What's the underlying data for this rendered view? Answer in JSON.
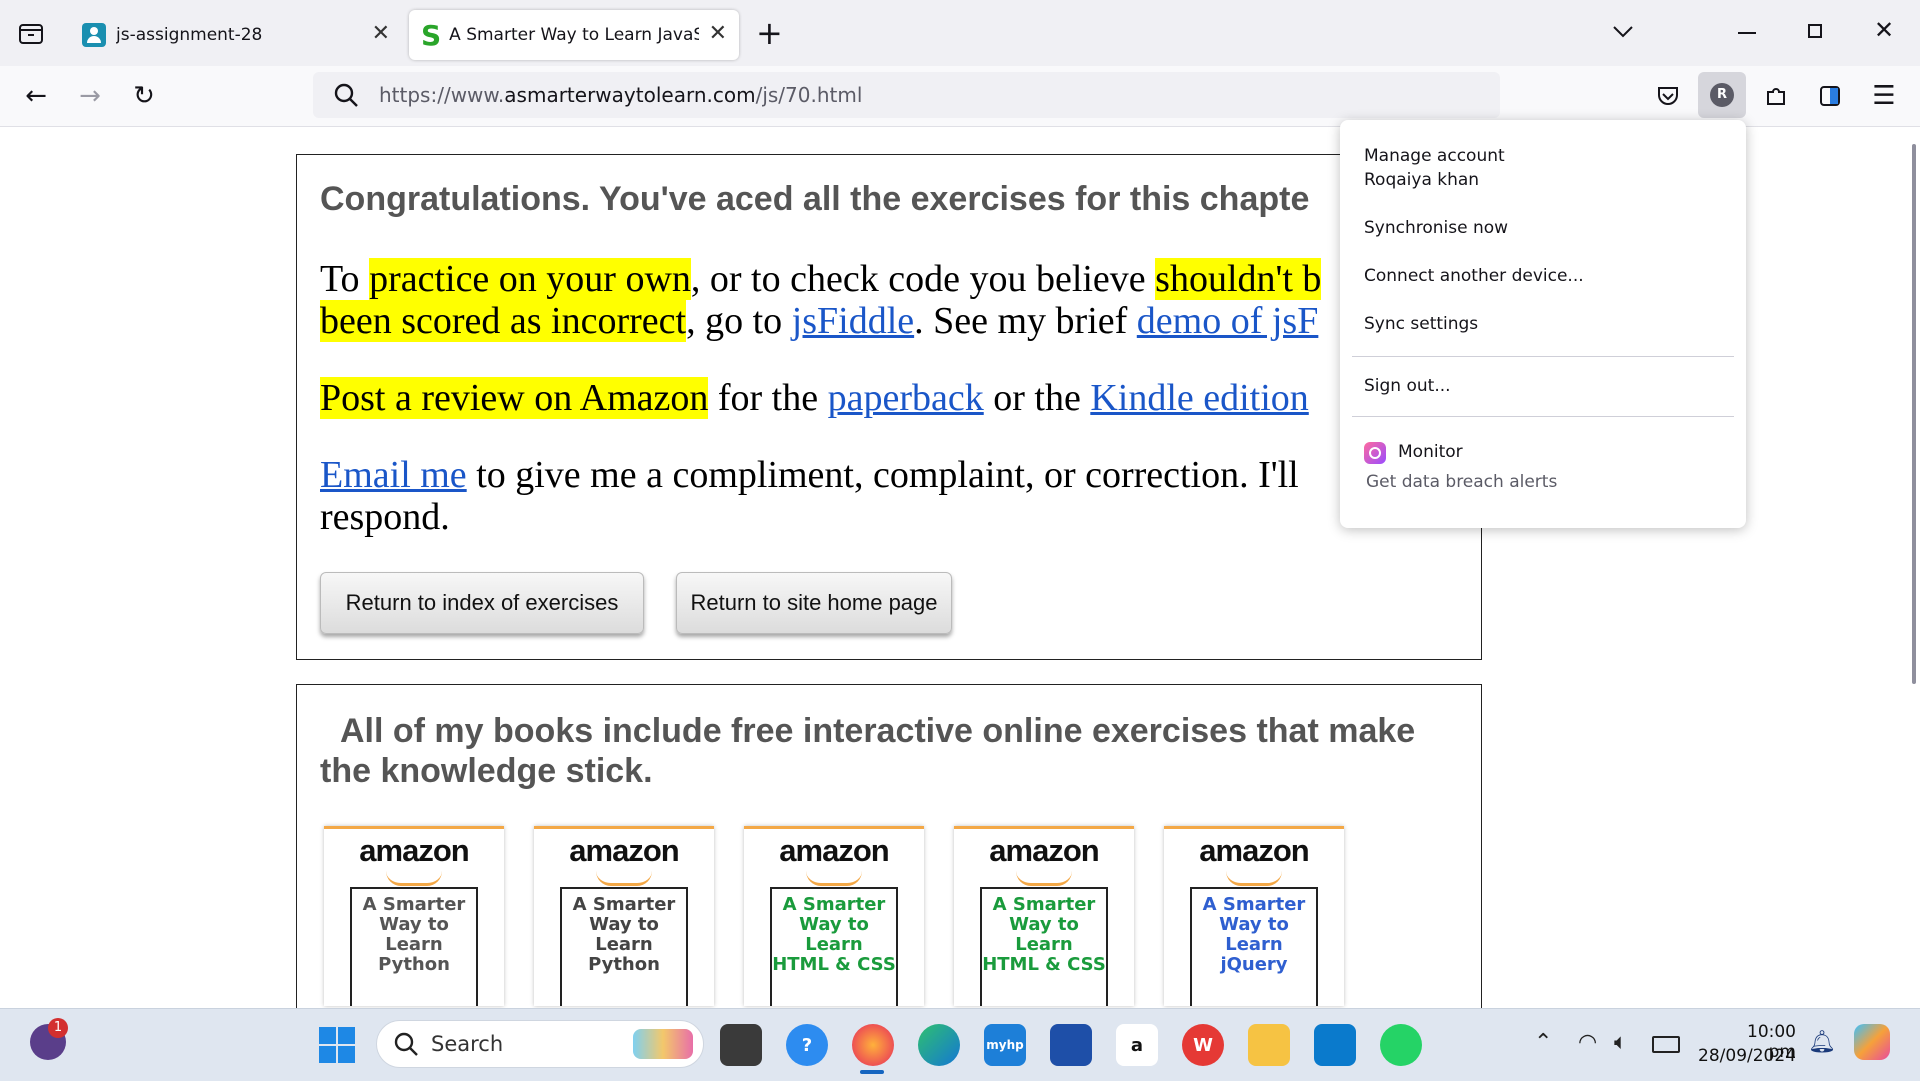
{
  "browser": {
    "tabs": [
      {
        "title": "js-assignment-28",
        "active": false
      },
      {
        "title": "A Smarter Way to Learn JavaScr",
        "active": true
      }
    ],
    "new_tab_label": "+",
    "url_prefix": "https://www.",
    "url_domain": "asmarterwaytolearn.com",
    "url_path": "/js/70.html",
    "account_initial": "R"
  },
  "page": {
    "congrats": "Congratulations. You've aced all the exercises for this chapte",
    "p1": {
      "t1": "To ",
      "h1": "practice on your own",
      "t2": ", or to check code you believe ",
      "h2": "shouldn't b",
      "h3": "been scored as incorrect",
      "t3": ", go to ",
      "l1": "jsFiddle",
      "t4": ". See my brief ",
      "l2": "demo of jsF"
    },
    "p2": {
      "h1": "Post a review on Amazon",
      "t1": " for the ",
      "l1": "paperback",
      "t2": " or the ",
      "l2": "Kindle edition"
    },
    "p3": {
      "l1": "Email me",
      "t1": " to give me a compliment, complaint, or correction. I'll",
      "t2": "respond."
    },
    "buttons": {
      "index": "Return to index of exercises",
      "home": "Return to site home page"
    },
    "books_heading_1": "All of my books include free interactive online exercises that make",
    "books_heading_2": "the knowledge stick.",
    "books": [
      {
        "brand": "amazon",
        "lines": [
          "A Smarter",
          "Way to",
          "Learn",
          "Python"
        ],
        "color": "#555555"
      },
      {
        "brand": "amazon",
        "lines": [
          "A Smarter",
          "Way to",
          "Learn",
          "Python"
        ],
        "color": "#444444"
      },
      {
        "brand": "amazon",
        "lines": [
          "A Smarter",
          "Way to",
          "Learn",
          "HTML & CSS"
        ],
        "color": "#1a9b3c"
      },
      {
        "brand": "amazon",
        "lines": [
          "A Smarter",
          "Way to",
          "Learn",
          "HTML & CSS"
        ],
        "color": "#1a9b3c"
      },
      {
        "brand": "amazon",
        "lines": [
          "A Smarter",
          "Way to",
          "Learn",
          "jQuery"
        ],
        "color": "#2f5fd0"
      }
    ]
  },
  "account_menu": {
    "manage": "Manage account",
    "user": "Roqaiya khan",
    "sync_now": "Synchronise now",
    "connect": "Connect another device...",
    "sync_settings": "Sync settings",
    "sign_out": "Sign out...",
    "monitor": "Monitor",
    "monitor_sub": "Get data breach alerts"
  },
  "taskbar": {
    "search_placeholder": "Search",
    "notification_count": "1",
    "time": "10:00 pm",
    "date": "28/09/2024"
  }
}
